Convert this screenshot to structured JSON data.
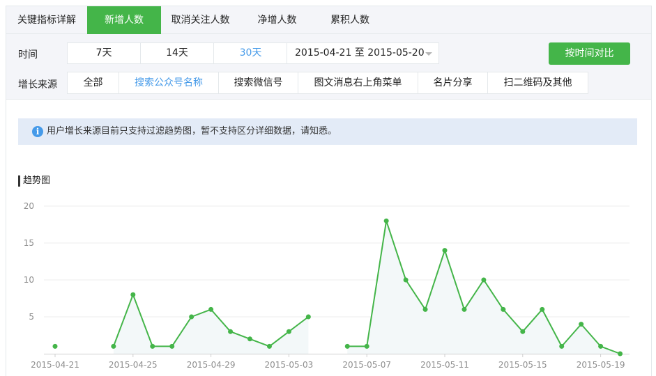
{
  "tabs": [
    {
      "label": "关键指标详解",
      "active": false
    },
    {
      "label": "新增人数",
      "active": true
    },
    {
      "label": "取消关注人数",
      "active": false
    },
    {
      "label": "净增人数",
      "active": false
    },
    {
      "label": "累积人数",
      "active": false
    }
  ],
  "filters": {
    "time_label": "时间",
    "time_options": [
      "7天",
      "14天",
      "30天"
    ],
    "time_selected": "30天",
    "date_range": "2015-04-21 至 2015-05-20",
    "compare_button": "按时间对比",
    "source_label": "增长来源",
    "source_options": [
      "全部",
      "搜索公众号名称",
      "搜索微信号",
      "图文消息右上角菜单",
      "名片分享",
      "扫二维码及其他"
    ],
    "source_selected": "搜索公众号名称"
  },
  "notice": {
    "icon": "info-icon",
    "text": "用户增长来源目前只支持过滤趋势图，暂不支持区分详细数据，请知悉。"
  },
  "colors": {
    "accent": "#44b549",
    "link": "#459ae9",
    "notice_bg": "#e3ebf7"
  },
  "chart_data": {
    "type": "line",
    "title": "趋势图",
    "x": [
      "2015-04-21",
      "2015-04-22",
      "2015-04-23",
      "2015-04-24",
      "2015-04-25",
      "2015-04-26",
      "2015-04-27",
      "2015-04-28",
      "2015-04-29",
      "2015-04-30",
      "2015-05-01",
      "2015-05-02",
      "2015-05-03",
      "2015-05-04",
      "2015-05-05",
      "2015-05-06",
      "2015-05-07",
      "2015-05-08",
      "2015-05-09",
      "2015-05-10",
      "2015-05-11",
      "2015-05-12",
      "2015-05-13",
      "2015-05-14",
      "2015-05-15",
      "2015-05-16",
      "2015-05-17",
      "2015-05-18",
      "2015-05-19",
      "2015-05-20"
    ],
    "series": [
      {
        "values": [
          1,
          null,
          null,
          1,
          8,
          1,
          1,
          5,
          6,
          3,
          2,
          1,
          3,
          5,
          null,
          1,
          1,
          18,
          10,
          6,
          14,
          6,
          10,
          6,
          3,
          6,
          1,
          4,
          1,
          0
        ],
        "color": "#44b549"
      }
    ],
    "xticks": [
      "2015-04-21",
      "2015-04-25",
      "2015-04-29",
      "2015-05-03",
      "2015-05-07",
      "2015-05-11",
      "2015-05-15",
      "2015-05-19"
    ],
    "yticks": [
      5,
      10,
      15,
      20
    ],
    "ylim": [
      0,
      20
    ],
    "grid": true,
    "area_fill": true
  }
}
